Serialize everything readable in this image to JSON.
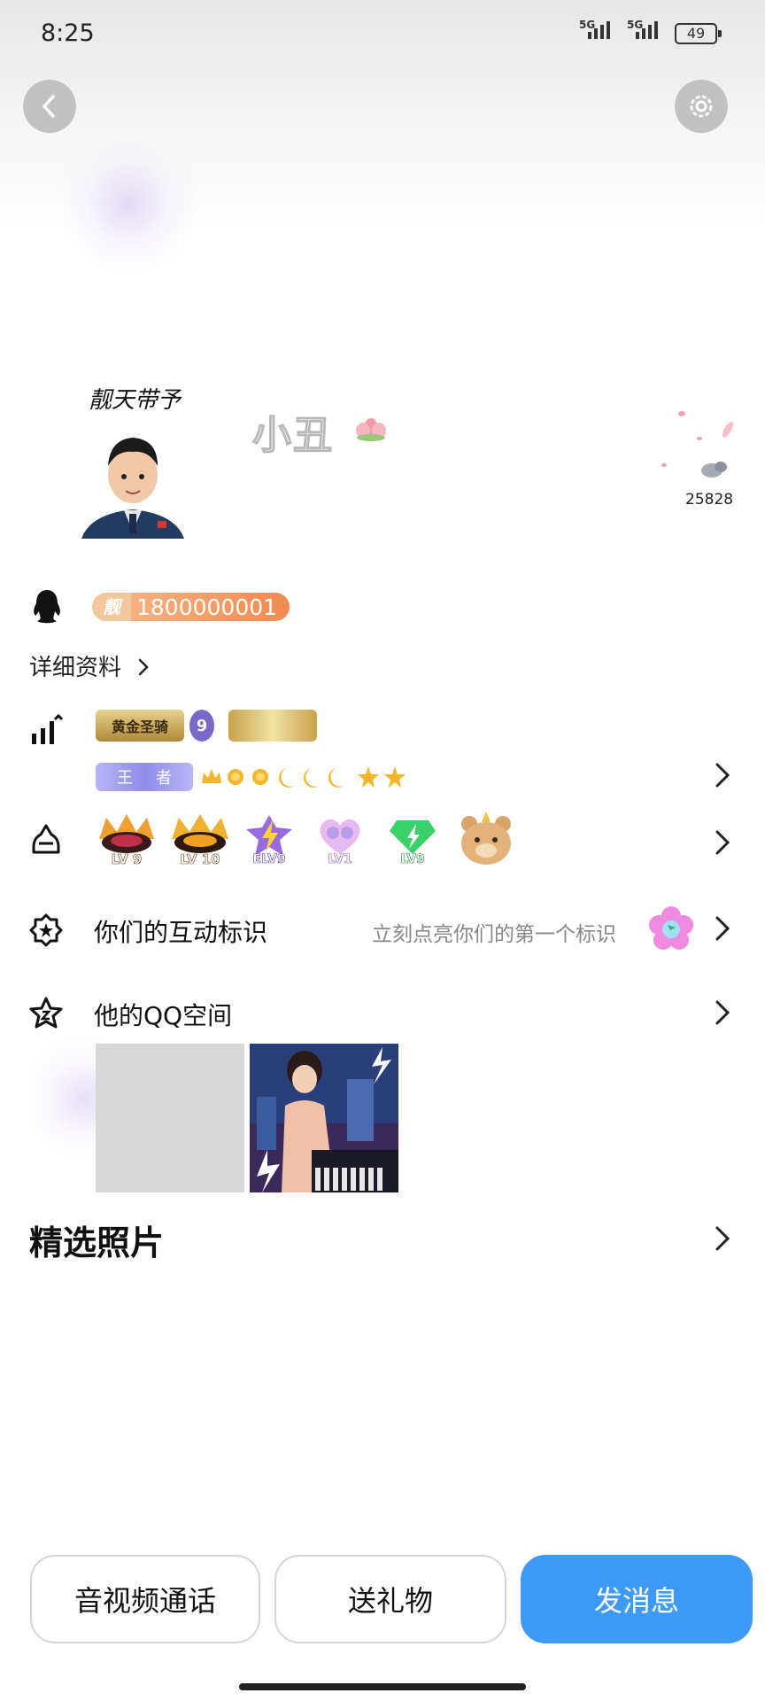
{
  "status_bar": {
    "time": "8:25",
    "network1": "5G",
    "network2": "5G",
    "battery": "49"
  },
  "header": {
    "back_icon": "back-arrow-icon",
    "settings_icon": "gear-icon"
  },
  "profile": {
    "nickname": "小丑",
    "likes": "25828",
    "qq_badge": "靓",
    "qq_number": "1800000001"
  },
  "detail_link": "详细资料",
  "game_titles": {
    "row1_a": "黄金圣骑",
    "row1_b": "9",
    "row2_a": "王",
    "row2_b": "者"
  },
  "achievements": [
    "LV 9",
    "LV 10",
    "ELV9",
    "LV1",
    "LV9"
  ],
  "interaction": {
    "label": "你们的互动标识",
    "hint": "立刻点亮你们的第一个标识"
  },
  "qzone": {
    "label": "他的QQ空间"
  },
  "photos": {
    "title": "精选照片"
  },
  "actions": {
    "call": "音视频通话",
    "gift": "送礼物",
    "message": "发消息"
  },
  "colors": {
    "primary": "#3d9af6",
    "badge": "#f08a50"
  }
}
